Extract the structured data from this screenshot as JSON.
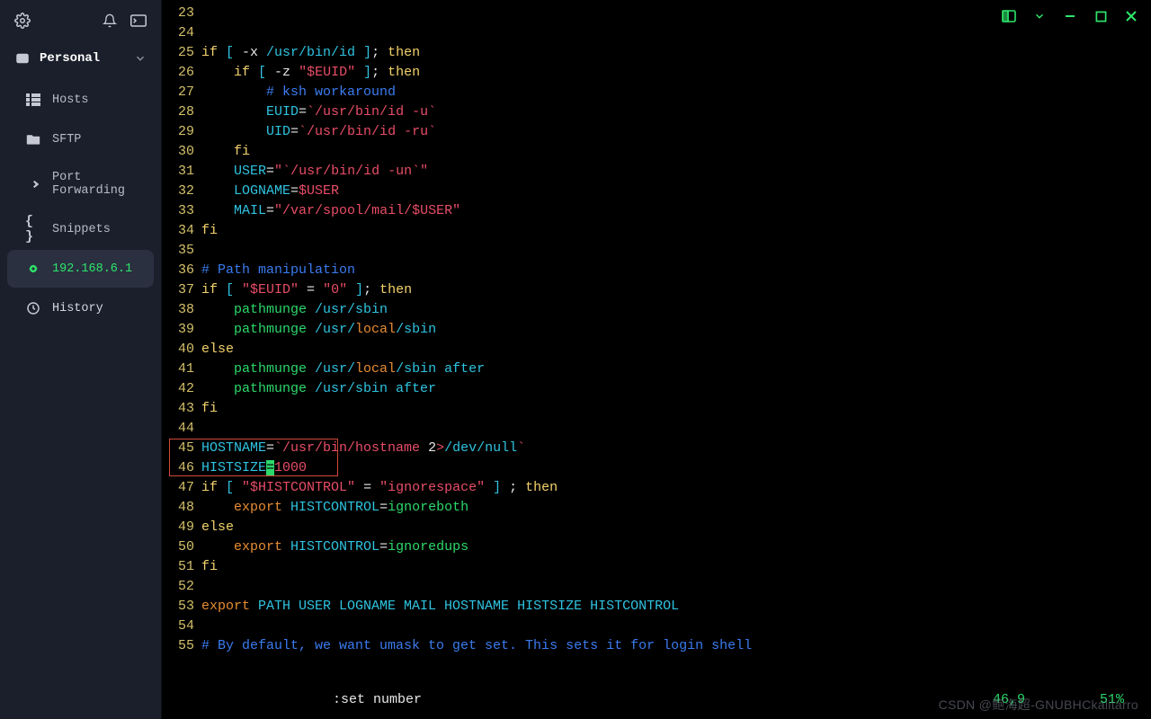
{
  "sidebar": {
    "workspace": "Personal",
    "items": [
      {
        "icon": "grid",
        "label": "Hosts"
      },
      {
        "icon": "folder",
        "label": "SFTP"
      },
      {
        "icon": "fwd",
        "label": "Port Forwarding"
      },
      {
        "icon": "braces",
        "label": "Snippets"
      },
      {
        "icon": "gear-green",
        "label": "192.168.6.1",
        "active": true
      },
      {
        "icon": "clock",
        "label": "History"
      }
    ]
  },
  "window": {
    "controls": [
      "panel",
      "down",
      "minimize",
      "maximize",
      "close"
    ]
  },
  "editor": {
    "status_cmd": ":set number",
    "status_pos": "46,9",
    "status_pct": "51%",
    "highlight_line": 46,
    "lines": [
      {
        "n": 23,
        "seg": []
      },
      {
        "n": 24,
        "seg": []
      },
      {
        "n": 25,
        "seg": [
          [
            "yellow",
            "if"
          ],
          [
            "cyan",
            " [ "
          ],
          [
            "white",
            "-x "
          ],
          [
            "cyan",
            "/usr/bin/id"
          ],
          [
            "cyan",
            " ]"
          ],
          [
            "white",
            "; "
          ],
          [
            "yellow",
            "then"
          ]
        ]
      },
      {
        "n": 26,
        "seg": [
          [
            "white",
            "    "
          ],
          [
            "yellow",
            "if"
          ],
          [
            "cyan",
            " [ "
          ],
          [
            "white",
            "-z "
          ],
          [
            "red",
            "\"$EUID\""
          ],
          [
            "cyan",
            " ]"
          ],
          [
            "white",
            "; "
          ],
          [
            "yellow",
            "then"
          ]
        ]
      },
      {
        "n": 27,
        "seg": [
          [
            "white",
            "        "
          ],
          [
            "blue",
            "# ksh workaround"
          ]
        ]
      },
      {
        "n": 28,
        "seg": [
          [
            "white",
            "        "
          ],
          [
            "cyan",
            "EUID"
          ],
          [
            "white",
            "="
          ],
          [
            "red",
            "`/usr/bin/id -u`"
          ]
        ]
      },
      {
        "n": 29,
        "seg": [
          [
            "white",
            "        "
          ],
          [
            "cyan",
            "UID"
          ],
          [
            "white",
            "="
          ],
          [
            "red",
            "`/usr/bin/id -ru`"
          ]
        ]
      },
      {
        "n": 30,
        "seg": [
          [
            "white",
            "    "
          ],
          [
            "yellow",
            "fi"
          ]
        ]
      },
      {
        "n": 31,
        "seg": [
          [
            "white",
            "    "
          ],
          [
            "cyan",
            "USER"
          ],
          [
            "white",
            "="
          ],
          [
            "red",
            "\""
          ],
          [
            "red",
            "`/usr/bin/id -un`"
          ],
          [
            "red",
            "\""
          ]
        ]
      },
      {
        "n": 32,
        "seg": [
          [
            "white",
            "    "
          ],
          [
            "cyan",
            "LOGNAME"
          ],
          [
            "white",
            "="
          ],
          [
            "red",
            "$USER"
          ]
        ]
      },
      {
        "n": 33,
        "seg": [
          [
            "white",
            "    "
          ],
          [
            "cyan",
            "MAIL"
          ],
          [
            "white",
            "="
          ],
          [
            "red",
            "\"/var/spool/mail/$USER\""
          ]
        ]
      },
      {
        "n": 34,
        "seg": [
          [
            "yellow",
            "fi"
          ]
        ]
      },
      {
        "n": 35,
        "seg": []
      },
      {
        "n": 36,
        "seg": [
          [
            "blue",
            "# Path manipulation"
          ]
        ]
      },
      {
        "n": 37,
        "seg": [
          [
            "yellow",
            "if"
          ],
          [
            "cyan",
            " [ "
          ],
          [
            "red",
            "\"$EUID\""
          ],
          [
            "white",
            " = "
          ],
          [
            "red",
            "\"0\""
          ],
          [
            "cyan",
            " ]"
          ],
          [
            "white",
            "; "
          ],
          [
            "yellow",
            "then"
          ]
        ]
      },
      {
        "n": 38,
        "seg": [
          [
            "white",
            "    "
          ],
          [
            "green",
            "pathmunge"
          ],
          [
            "cyan",
            " /usr/sbin"
          ]
        ]
      },
      {
        "n": 39,
        "seg": [
          [
            "white",
            "    "
          ],
          [
            "green",
            "pathmunge"
          ],
          [
            "cyan",
            " /usr/"
          ],
          [
            "orange",
            "local"
          ],
          [
            "cyan",
            "/sbin"
          ]
        ]
      },
      {
        "n": 40,
        "seg": [
          [
            "yellow",
            "else"
          ]
        ]
      },
      {
        "n": 41,
        "seg": [
          [
            "white",
            "    "
          ],
          [
            "green",
            "pathmunge"
          ],
          [
            "cyan",
            " /usr/"
          ],
          [
            "orange",
            "local"
          ],
          [
            "cyan",
            "/sbin after"
          ]
        ]
      },
      {
        "n": 42,
        "seg": [
          [
            "white",
            "    "
          ],
          [
            "green",
            "pathmunge"
          ],
          [
            "cyan",
            " /usr/sbin after"
          ]
        ]
      },
      {
        "n": 43,
        "seg": [
          [
            "yellow",
            "fi"
          ]
        ]
      },
      {
        "n": 44,
        "seg": []
      },
      {
        "n": 45,
        "seg": [
          [
            "cyan",
            "HOSTNAME"
          ],
          [
            "white",
            "="
          ],
          [
            "red",
            "`/usr/bin/hostname "
          ],
          [
            "white",
            "2"
          ],
          [
            "red",
            ">"
          ],
          [
            "cyan",
            "/dev/null"
          ],
          [
            "red",
            "`"
          ]
        ]
      },
      {
        "n": 46,
        "seg": [
          [
            "cyan",
            "HISTSIZE"
          ],
          [
            "cursor",
            "="
          ],
          [
            "red",
            "1000"
          ]
        ]
      },
      {
        "n": 47,
        "seg": [
          [
            "yellow",
            "if"
          ],
          [
            "cyan",
            " [ "
          ],
          [
            "red",
            "\"$HISTCONTROL\""
          ],
          [
            "white",
            " = "
          ],
          [
            "red",
            "\"ignorespace\""
          ],
          [
            "cyan",
            " ]"
          ],
          [
            "white",
            " ; "
          ],
          [
            "yellow",
            "then"
          ]
        ]
      },
      {
        "n": 48,
        "seg": [
          [
            "white",
            "    "
          ],
          [
            "orange",
            "export"
          ],
          [
            "cyan",
            " HISTCONTROL"
          ],
          [
            "white",
            "="
          ],
          [
            "green",
            "ignoreboth"
          ]
        ]
      },
      {
        "n": 49,
        "seg": [
          [
            "yellow",
            "else"
          ]
        ]
      },
      {
        "n": 50,
        "seg": [
          [
            "white",
            "    "
          ],
          [
            "orange",
            "export"
          ],
          [
            "cyan",
            " HISTCONTROL"
          ],
          [
            "white",
            "="
          ],
          [
            "green",
            "ignoredups"
          ]
        ]
      },
      {
        "n": 51,
        "seg": [
          [
            "yellow",
            "fi"
          ]
        ]
      },
      {
        "n": 52,
        "seg": []
      },
      {
        "n": 53,
        "seg": [
          [
            "orange",
            "export"
          ],
          [
            "cyan",
            " PATH USER LOGNAME MAIL HOSTNAME HISTSIZE HISTCONTROL"
          ]
        ]
      },
      {
        "n": 54,
        "seg": []
      },
      {
        "n": 55,
        "seg": [
          [
            "blue",
            "# By default, we want umask to get set. This sets it for login shell"
          ]
        ]
      }
    ]
  },
  "watermark": "CSDN @鲍海超-GNUBHCkalitarro"
}
